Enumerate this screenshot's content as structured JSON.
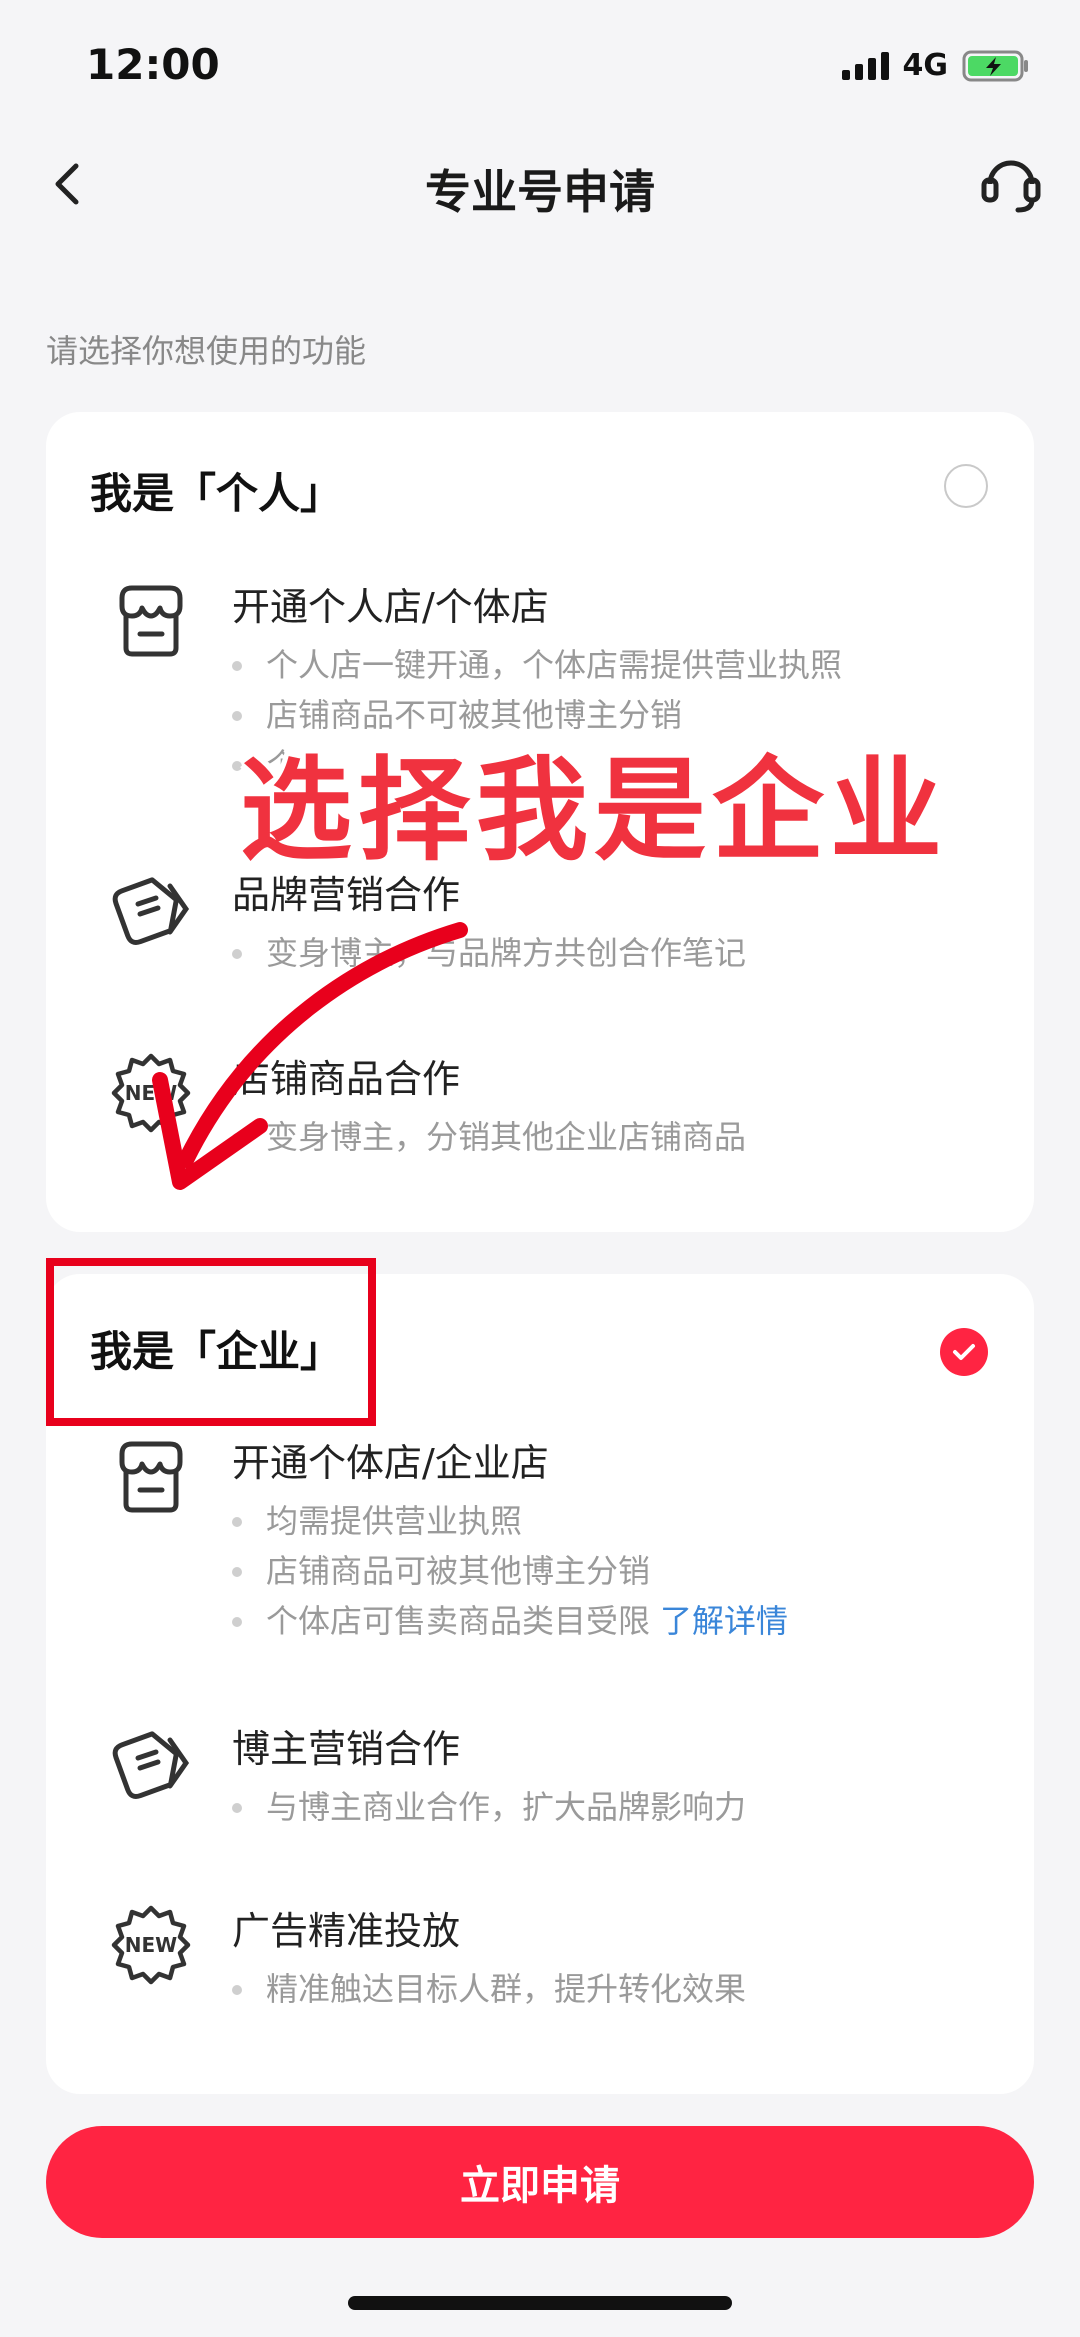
{
  "status": {
    "time": "12:00",
    "network": "4G"
  },
  "nav": {
    "title": "专业号申请"
  },
  "hint": "请选择你想使用的功能",
  "cards": [
    {
      "title": "我是「个人」",
      "selected": false,
      "features": [
        {
          "icon": "store-icon",
          "title": "开通个人店/个体店",
          "bullets": [
            "个人店一键开通，个体店需提供营业执照",
            "店铺商品不可被其他博主分销",
            "个"
          ]
        },
        {
          "icon": "tag-icon",
          "title": "品牌营销合作",
          "bullets": [
            "变身博主，与品牌方共创合作笔记"
          ]
        },
        {
          "icon": "new-badge-icon",
          "title": "店铺商品合作",
          "bullets": [
            "变身博主，分销其他企业店铺商品"
          ]
        }
      ]
    },
    {
      "title": "我是「企业」",
      "selected": true,
      "features": [
        {
          "icon": "store-icon",
          "title": "开通个体店/企业店",
          "bullets": [
            "均需提供营业执照",
            "店铺商品可被其他博主分销",
            "个体店可售卖商品类目受限"
          ],
          "link": "了解详情"
        },
        {
          "icon": "tag-icon",
          "title": "博主营销合作",
          "bullets": [
            "与博主商业合作，扩大品牌影响力"
          ]
        },
        {
          "icon": "new-badge-icon",
          "title": "广告精准投放",
          "bullets": [
            "精准触达目标人群，提升转化效果"
          ]
        }
      ]
    }
  ],
  "annotation": {
    "text": "选择我是企业",
    "color": "#f0323f"
  },
  "cta": {
    "label": "立即申请",
    "color": "#ff2442"
  },
  "icons": {
    "back": "back-arrow-icon",
    "support": "headset-icon",
    "new_badge_text": "NEW"
  }
}
